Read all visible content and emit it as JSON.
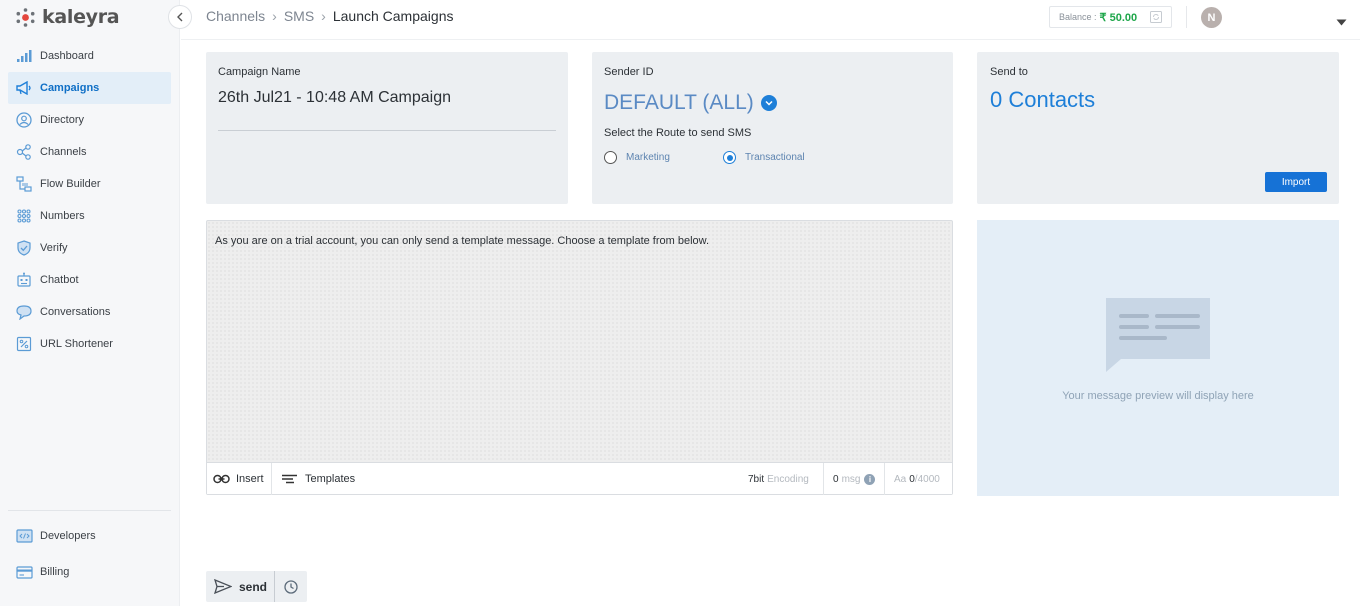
{
  "brand": {
    "name": "kaleyra"
  },
  "sidebar": {
    "items": [
      {
        "label": "Dashboard",
        "icon": "bar-chart-icon"
      },
      {
        "label": "Campaigns",
        "icon": "megaphone-icon",
        "active": true
      },
      {
        "label": "Directory",
        "icon": "contact-icon"
      },
      {
        "label": "Channels",
        "icon": "share-icon"
      },
      {
        "label": "Flow Builder",
        "icon": "flow-icon"
      },
      {
        "label": "Numbers",
        "icon": "dialpad-icon"
      },
      {
        "label": "Verify",
        "icon": "shield-icon"
      },
      {
        "label": "Chatbot",
        "icon": "robot-icon"
      },
      {
        "label": "Conversations",
        "icon": "chat-icon"
      },
      {
        "label": "URL Shortener",
        "icon": "link-icon"
      }
    ],
    "bottom": [
      {
        "label": "Developers",
        "icon": "code-icon"
      },
      {
        "label": "Billing",
        "icon": "card-icon"
      }
    ]
  },
  "header": {
    "breadcrumb": [
      "Channels",
      "SMS",
      "Launch Campaigns"
    ],
    "balance_label": "Balance :",
    "balance_amount": "₹ 50.00",
    "avatar_initial": "N"
  },
  "campaign": {
    "label": "Campaign Name",
    "value": "26th Jul21 - 10:48 AM Campaign"
  },
  "sender": {
    "label": "Sender ID",
    "value": "DEFAULT (ALL)",
    "route_label": "Select the Route to send SMS",
    "routes": [
      {
        "label": "Marketing",
        "selected": false
      },
      {
        "label": "Transactional",
        "selected": true
      }
    ]
  },
  "send_to": {
    "label": "Send to",
    "value": "0 Contacts",
    "import_label": "Import"
  },
  "message": {
    "trial_notice": "As you are on a trial account, you can only send a template message. Choose a template from below.",
    "insert_label": "Insert",
    "templates_label": "Templates",
    "encoding_value": "7bit",
    "encoding_label": "Encoding",
    "msg_count": "0",
    "msg_label": "msg",
    "char_prefix": "Aa",
    "char_count": "0",
    "char_limit": "/4000"
  },
  "preview": {
    "placeholder": "Your message preview will display here"
  },
  "actions": {
    "send_label": "send"
  },
  "colors": {
    "accent": "#1e7fd8",
    "balance": "#1ea64a",
    "active_nav_bg": "#e3eef8"
  }
}
